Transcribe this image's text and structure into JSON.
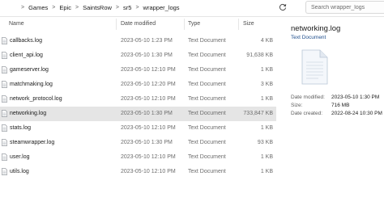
{
  "breadcrumbs": [
    "Games",
    "Epic",
    "SaintsRow",
    "sr5",
    "wrapper_logs"
  ],
  "search": {
    "placeholder": "Search wrapper_logs"
  },
  "icons": {
    "refresh": "refresh-icon",
    "file": "text-document-icon"
  },
  "columns": {
    "name": "Name",
    "date": "Date modified",
    "type": "Type",
    "size": "Size"
  },
  "files": [
    {
      "name": "callbacks.log",
      "date": "2023-05-10 1:23 PM",
      "type": "Text Document",
      "size": "4 KB",
      "selected": false
    },
    {
      "name": "client_api.log",
      "date": "2023-05-10 1:30 PM",
      "type": "Text Document",
      "size": "91,638 KB",
      "selected": false
    },
    {
      "name": "gameserver.log",
      "date": "2023-05-10 12:10 PM",
      "type": "Text Document",
      "size": "1 KB",
      "selected": false
    },
    {
      "name": "matchmaking.log",
      "date": "2023-05-10 12:20 PM",
      "type": "Text Document",
      "size": "3 KB",
      "selected": false
    },
    {
      "name": "network_protocol.log",
      "date": "2023-05-10 12:10 PM",
      "type": "Text Document",
      "size": "1 KB",
      "selected": false
    },
    {
      "name": "networking.log",
      "date": "2023-05-10 1:30 PM",
      "type": "Text Document",
      "size": "733,847 KB",
      "selected": true
    },
    {
      "name": "stats.log",
      "date": "2023-05-10 12:10 PM",
      "type": "Text Document",
      "size": "1 KB",
      "selected": false
    },
    {
      "name": "steamwrapper.log",
      "date": "2023-05-10 1:30 PM",
      "type": "Text Document",
      "size": "93 KB",
      "selected": false
    },
    {
      "name": "user.log",
      "date": "2023-05-10 12:10 PM",
      "type": "Text Document",
      "size": "1 KB",
      "selected": false
    },
    {
      "name": "utils.log",
      "date": "2023-05-10 12:10 PM",
      "type": "Text Document",
      "size": "1 KB",
      "selected": false
    }
  ],
  "preview": {
    "title": "networking.log",
    "subtitle": "Text Document",
    "date_modified_label": "Date modified:",
    "date_modified": "2023-05-10 1:30 PM",
    "size_label": "Size:",
    "size": "716 MB",
    "date_created_label": "Date created:",
    "date_created": "2022-08-24 10:30 PM"
  },
  "colors": {
    "selection": "#e5e5e5",
    "link": "#1f4e8c"
  }
}
